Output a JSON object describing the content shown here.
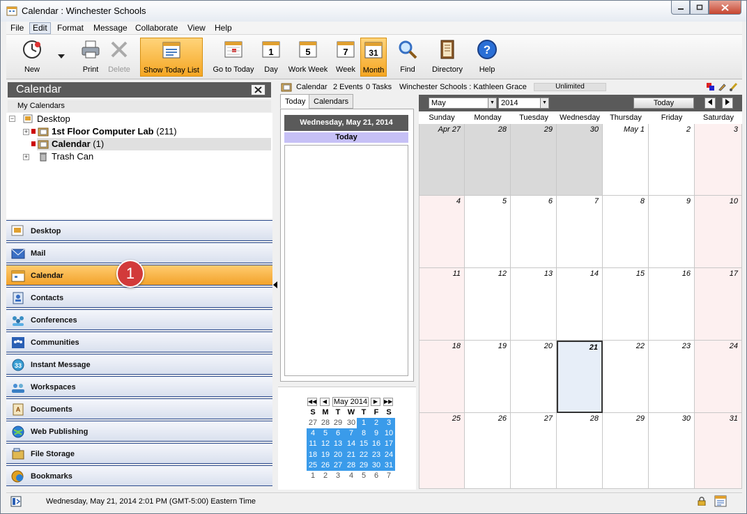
{
  "window": {
    "title": "Calendar : Winchester Schools"
  },
  "menu": [
    "File",
    "Edit",
    "Format",
    "Message",
    "Collaborate",
    "View",
    "Help"
  ],
  "toolbar": {
    "new": "New",
    "print": "Print",
    "delete": "Delete",
    "show_today_list": "Show Today List",
    "go_to_today": "Go to Today",
    "day": "Day",
    "work_week": "Work Week",
    "week": "Week",
    "month": "Month",
    "find": "Find",
    "directory": "Directory",
    "help": "Help",
    "day_icon_num": "1",
    "work_week_icon_num": "5",
    "week_icon_num": "7",
    "month_icon_num": "31"
  },
  "left_panel": {
    "title": "Calendar",
    "my_calendars": "My Calendars",
    "tree": {
      "desktop": "Desktop",
      "lab": "1st Floor Computer Lab",
      "lab_count": "(211)",
      "calendar": "Calendar",
      "calendar_count": "(1)",
      "trash": "Trash Can"
    }
  },
  "nav": [
    "Desktop",
    "Mail",
    "Calendar",
    "Contacts",
    "Conferences",
    "Communities",
    "Instant Message",
    "Workspaces",
    "Documents",
    "Web Publishing",
    "File Storage",
    "Bookmarks"
  ],
  "badge": "1",
  "info_bar": {
    "calendar": "Calendar",
    "events": "2 Events",
    "tasks": "0 Tasks",
    "user": "Winchester Schools : Kathleen Grace",
    "quota": "Unlimited"
  },
  "today_panel": {
    "tab_today": "Today",
    "tab_calendars": "Calendars",
    "date": "Wednesday, May 21, 2014",
    "today_label": "Today"
  },
  "mini_cal": {
    "title": "May 2014",
    "weekdays": [
      "S",
      "M",
      "T",
      "W",
      "T",
      "F",
      "S"
    ],
    "days": [
      "27",
      "28",
      "29",
      "30",
      "1",
      "2",
      "3",
      "4",
      "5",
      "6",
      "7",
      "8",
      "9",
      "10",
      "11",
      "12",
      "13",
      "14",
      "15",
      "16",
      "17",
      "18",
      "19",
      "20",
      "21",
      "22",
      "23",
      "24",
      "25",
      "26",
      "27",
      "28",
      "29",
      "30",
      "31",
      "1",
      "2",
      "3",
      "4",
      "5",
      "6",
      "7"
    ]
  },
  "month_view": {
    "month": "May",
    "year": "2014",
    "today_button": "Today",
    "weekdays": [
      "Sunday",
      "Monday",
      "Tuesday",
      "Wednesday",
      "Thursday",
      "Friday",
      "Saturday"
    ],
    "days": [
      "Apr 27",
      "28",
      "29",
      "30",
      "May 1",
      "2",
      "3",
      "4",
      "5",
      "6",
      "7",
      "8",
      "9",
      "10",
      "11",
      "12",
      "13",
      "14",
      "15",
      "16",
      "17",
      "18",
      "19",
      "20",
      "21",
      "22",
      "23",
      "24",
      "25",
      "26",
      "27",
      "28",
      "29",
      "30",
      "31"
    ]
  },
  "status": {
    "text": "Wednesday, May 21, 2014 2:01 PM (GMT-5:00) Eastern Time"
  }
}
